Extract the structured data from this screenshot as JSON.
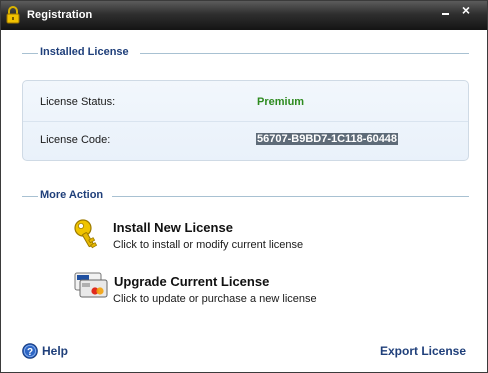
{
  "window": {
    "title": "Registration",
    "close_glyph": "×",
    "icons": {
      "title": "lock-icon",
      "minimize": "minimize-icon",
      "close": "close-icon"
    }
  },
  "installed_license": {
    "heading": "Installed License",
    "status_label": "License Status:",
    "status_value": "Premium",
    "code_label": "License Code:",
    "code_value": "56707-B9BD7-1C118-60448"
  },
  "more_action": {
    "heading": "More Action",
    "actions": [
      {
        "title": "Install New License",
        "description": "Click to install or modify current license",
        "icon": "key-icon"
      },
      {
        "title": "Upgrade Current License",
        "description": "Click to update or purchase a new license",
        "icon": "credit-cards-icon"
      }
    ]
  },
  "footer": {
    "help_label": "Help",
    "help_icon": "help-icon",
    "export_label": "Export License"
  },
  "colors": {
    "heading": "#1f3f7a",
    "status_premium": "#2e8b1f",
    "selection": "#5e6b78",
    "titlebar": "#2f2f2f"
  }
}
